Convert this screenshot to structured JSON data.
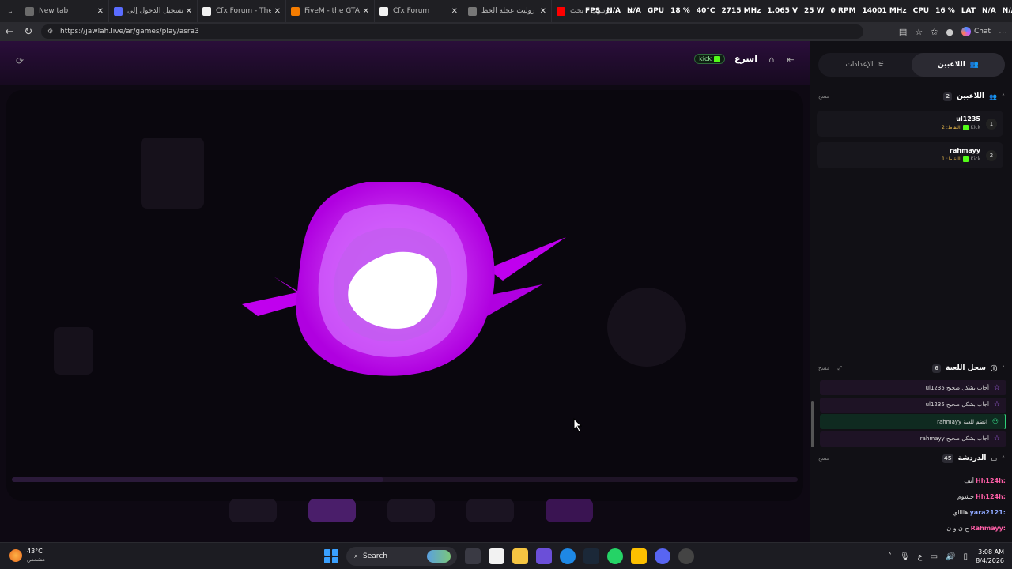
{
  "browser": {
    "tabs": [
      {
        "title": "New tab",
        "color": "#6b6b6b"
      },
      {
        "title": "تسجيل الدخول إلى ...",
        "color": "#5a6cff"
      },
      {
        "title": "Cfx Forum - The hom",
        "color": "#f2f2f2"
      },
      {
        "title": "FiveM - the GTA V m",
        "color": "#f57c00"
      },
      {
        "title": "Cfx Forum",
        "color": "#f2f2f2"
      },
      {
        "title": "روليت عجلة الحظ - ...",
        "color": "#777"
      },
      {
        "title": "يوتيوب - بحث",
        "color": "#ff0000"
      }
    ],
    "overlay_stats": [
      "FPS",
      "N/A",
      "N/A",
      "GPU",
      "18 %",
      "40°C",
      "2715 MHz",
      "1.065 V",
      "25 W",
      "0 RPM",
      "14001 MHz",
      "CPU",
      "16 %",
      "LAT",
      "N/A",
      "N/A"
    ],
    "url": "https://jawlah.live/ar/games/play/asra3",
    "chat_button": "Chat"
  },
  "game": {
    "title": "اسرع",
    "kick_label": "kick"
  },
  "sidebar": {
    "tabs": [
      {
        "label": "اللاعبين",
        "active": true
      },
      {
        "label": "الإعدادات",
        "active": false
      }
    ],
    "players_section": {
      "title": "اللاعبين",
      "count": "2",
      "clear": "مسح",
      "players": [
        {
          "rank": "1",
          "name": "ul1235",
          "platform": "Kick",
          "points": "النقاط: 2"
        },
        {
          "rank": "2",
          "name": "rahmayy",
          "platform": "Kick",
          "points": "النقاط: 1"
        }
      ]
    },
    "log_section": {
      "title": "سجل اللعبة",
      "count": "6",
      "clear": "مسح",
      "entries": [
        {
          "text": "ul1235 أجاب بشكل صحيح",
          "type": "answer"
        },
        {
          "text": "ul1235 أجاب بشكل صحيح",
          "type": "answer"
        },
        {
          "text": "rahmayy انضم للعبة",
          "type": "join"
        },
        {
          "text": "rahmayy أجاب بشكل صحيح",
          "type": "answer"
        }
      ]
    },
    "chat_section": {
      "title": "الدردشة",
      "count": "45",
      "clear": "مسح",
      "messages": [
        {
          "user": "Hh124h:",
          "text": "أنف",
          "color": "#ff5fa8"
        },
        {
          "user": "Hh124h:",
          "text": "خشوم",
          "color": "#ff5fa8"
        },
        {
          "user": "yara2121:",
          "text": "هااااي",
          "color": "#8fa8ff"
        },
        {
          "user": "Rahmayy:",
          "text": "ح ن و ن",
          "color": "#ff5fa8"
        }
      ]
    }
  },
  "taskbar": {
    "temp": "43°C",
    "weather": "مشمس",
    "search": "Search",
    "time": "3:08 AM",
    "date": "8/4/2026",
    "lang": "ع"
  },
  "colors": {
    "accent": "#b100e8",
    "kick": "#53fc18",
    "points": "#e8b84a"
  }
}
